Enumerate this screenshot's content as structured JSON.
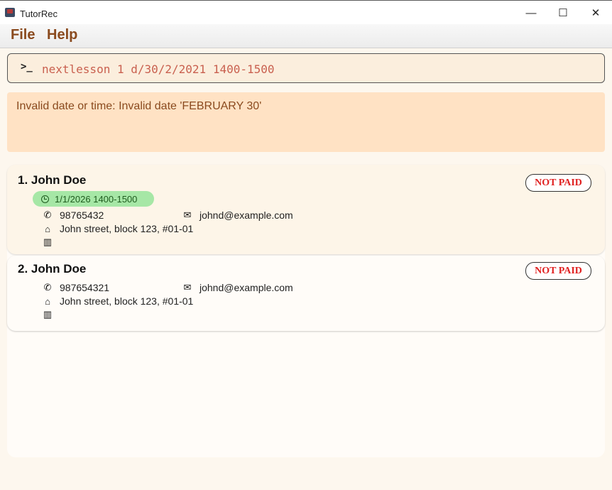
{
  "window": {
    "title": "TutorRec"
  },
  "menu": {
    "file": "File",
    "help": "Help"
  },
  "command": {
    "value": "nextlesson 1 d/30/2/2021 1400-1500",
    "prompt_symbol": ">_"
  },
  "result": {
    "message": "Invalid date or time: Invalid date 'FEBRUARY 30'"
  },
  "persons": [
    {
      "index_name": "1. John Doe",
      "lesson": "1/1/2026 1400-1500",
      "phone": "98765432",
      "email": "johnd@example.com",
      "address": "John street, block 123, #01-01",
      "payment_status": "NOT PAID"
    },
    {
      "index_name": "2. John    Doe",
      "phone": "987654321",
      "email": "johnd@example.com",
      "address": "John street, block 123, #01-01",
      "payment_status": "NOT PAID"
    }
  ],
  "colors": {
    "accent": "#8a4a1e",
    "command_text": "#c9604f",
    "result_bg": "#ffe2c4",
    "paid_text": "#e02020",
    "lesson_badge": "#a6e7a6"
  }
}
